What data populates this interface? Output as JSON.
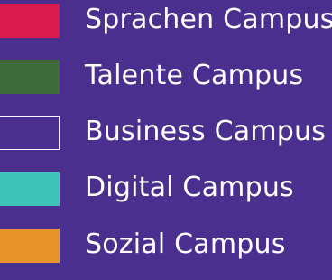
{
  "legend": {
    "items": [
      {
        "label": "Sprachen Campus",
        "color": "#d81b4a",
        "style": "filled"
      },
      {
        "label": "Talente Campus",
        "color": "#3f6b3c",
        "style": "filled"
      },
      {
        "label": "Business Campus",
        "color": "#ffffff",
        "style": "outline"
      },
      {
        "label": "Digital Campus",
        "color": "#3fc4b8",
        "style": "filled"
      },
      {
        "label": "Sozial Campus",
        "color": "#e8922a",
        "style": "filled"
      }
    ]
  }
}
